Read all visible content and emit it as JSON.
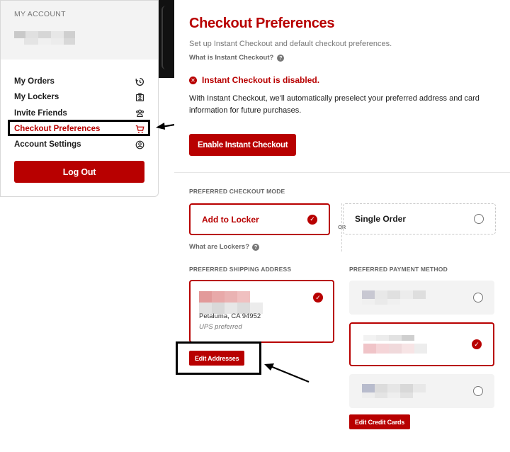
{
  "sidebar": {
    "account_label": "MY ACCOUNT",
    "items": [
      {
        "label": "My Orders",
        "icon": "history-icon"
      },
      {
        "label": "My Lockers",
        "icon": "locker-icon"
      },
      {
        "label": "Invite Friends",
        "icon": "friends-icon"
      },
      {
        "label": "Checkout Preferences",
        "icon": "cart-icon",
        "active": true
      },
      {
        "label": "Account Settings",
        "icon": "user-circle-icon"
      }
    ],
    "logout_label": "Log Out"
  },
  "main": {
    "title": "Checkout Preferences",
    "subtitle": "Set up Instant Checkout and default checkout preferences.",
    "what_is_link": "What is Instant Checkout?",
    "status": "Instant Checkout is disabled.",
    "description": "With Instant Checkout, we'll automatically preselect your preferred address and card information for future purchases.",
    "enable_button": "Enable Instant Checkout",
    "checkout_mode": {
      "label": "PREFERRED CHECKOUT MODE",
      "options": [
        "Add to Locker",
        "Single Order"
      ],
      "selected": "Add to Locker",
      "or_label": "OR",
      "lockers_link": "What are Lockers?"
    },
    "shipping": {
      "label": "PREFERRED SHIPPING ADDRESS",
      "city_line": "Petaluma, CA 94952",
      "note": "UPS preferred",
      "edit_button": "Edit Addresses"
    },
    "payment": {
      "label": "PREFERRED PAYMENT METHOD",
      "selected_index": 1,
      "edit_button": "Edit Credit Cards"
    }
  },
  "colors": {
    "brand_red": "#b80000",
    "text": "#1c1c1c",
    "muted": "#777777"
  }
}
